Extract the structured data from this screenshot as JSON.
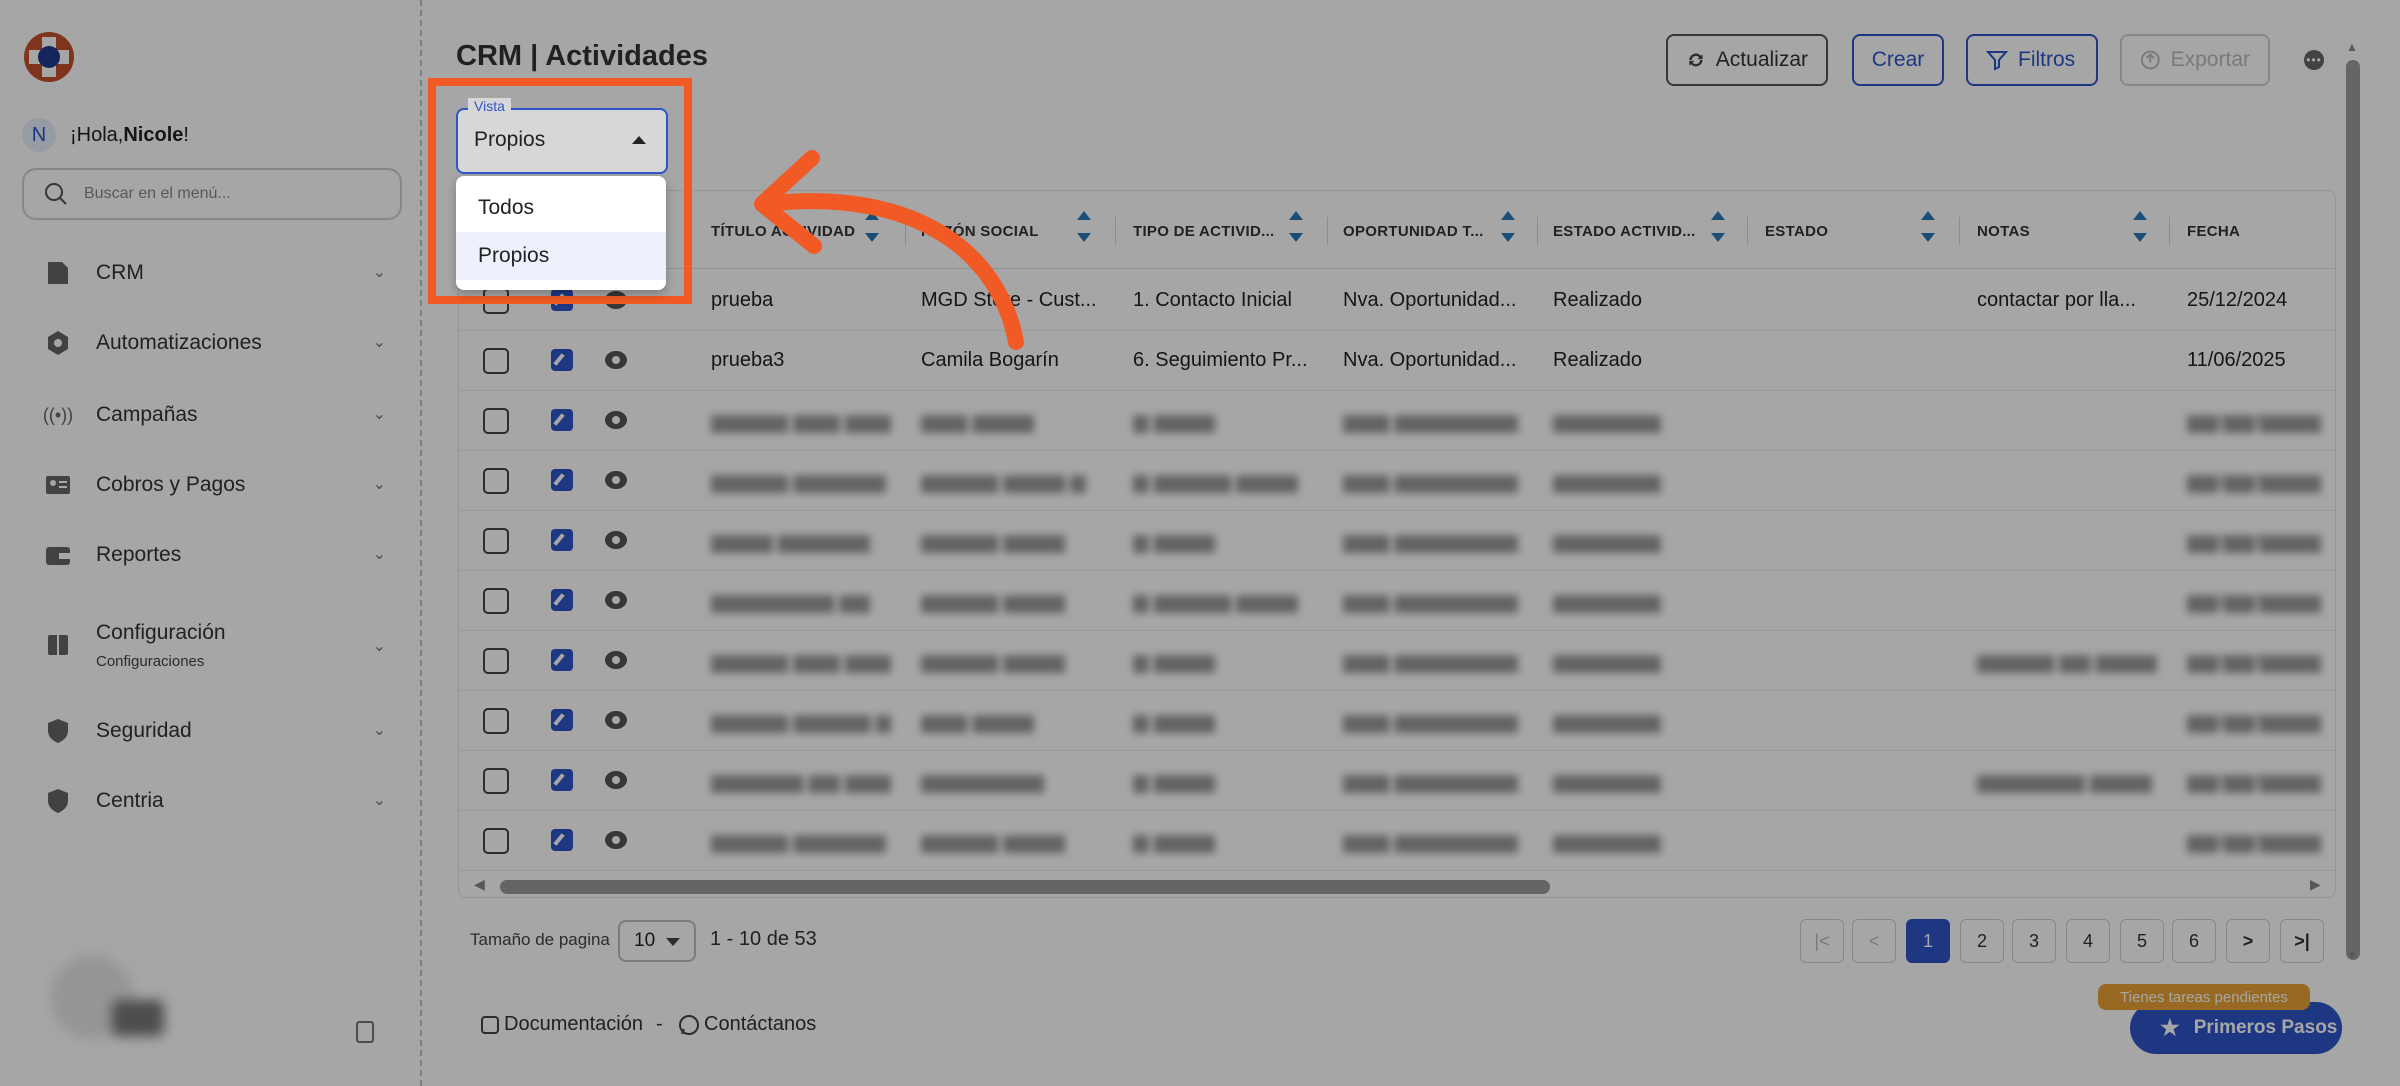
{
  "user": {
    "greeting": "¡Hola, ",
    "name": "Nicole",
    "suffix": "!",
    "avatar": "N"
  },
  "search": {
    "placeholder": "Buscar en el menú..."
  },
  "sidebar": {
    "items": [
      {
        "label": "CRM",
        "icon": "document-icon"
      },
      {
        "label": "Automatizaciones",
        "icon": "hexagon-icon"
      },
      {
        "label": "Campañas",
        "icon": "broadcast-icon"
      },
      {
        "label": "Cobros y Pagos",
        "icon": "id-card-icon"
      },
      {
        "label": "Reportes",
        "icon": "wallet-icon"
      },
      {
        "label": "Configuración",
        "sub": "Configuraciones",
        "icon": "book-icon"
      },
      {
        "label": "Seguridad",
        "icon": "shield-icon"
      },
      {
        "label": "Centria",
        "icon": "shield-icon"
      }
    ]
  },
  "page": {
    "title": "CRM | Actividades"
  },
  "toolbar": {
    "refresh": "Actualizar",
    "create": "Crear",
    "filters": "Filtros",
    "export": "Exportar"
  },
  "vista": {
    "label": "Vista",
    "value": "Propios",
    "options": [
      "Todos",
      "Propios"
    ]
  },
  "table": {
    "columns": [
      "TÍTULO ACTIVIDAD",
      "RAZÓN SOCIAL",
      "TIPO DE ACTIVID...",
      "OPORTUNIDAD T...",
      "ESTADO ACTIVID...",
      "ESTADO",
      "NOTAS",
      "FECHA"
    ],
    "rows": [
      [
        "prueba",
        "MGD Store - Cust...",
        "1. Contacto Inicial",
        "Nva. Oportunidad...",
        "Realizado",
        "",
        "contactar por lla...",
        "25/12/2024"
      ],
      [
        "prueba3",
        "Camila Bogarín",
        "6. Seguimiento Pr...",
        "Nva. Oportunidad...",
        "Realizado",
        "",
        "",
        "11/06/2025"
      ]
    ]
  },
  "pagination": {
    "size_label": "Tamaño de pagina",
    "size": "10",
    "range": "1 - 10 de 53",
    "pages": [
      "1",
      "2",
      "3",
      "4",
      "5",
      "6"
    ],
    "active": "1"
  },
  "footer": {
    "docs": "Documentación",
    "sep": "-",
    "contact": "Contáctanos"
  },
  "tasks_badge": "Tienes tareas pendientes",
  "first_steps": "Primeros Pasos",
  "colors": {
    "accent": "#2f55c9",
    "highlight": "#f15a24",
    "badge": "#e8a236"
  }
}
